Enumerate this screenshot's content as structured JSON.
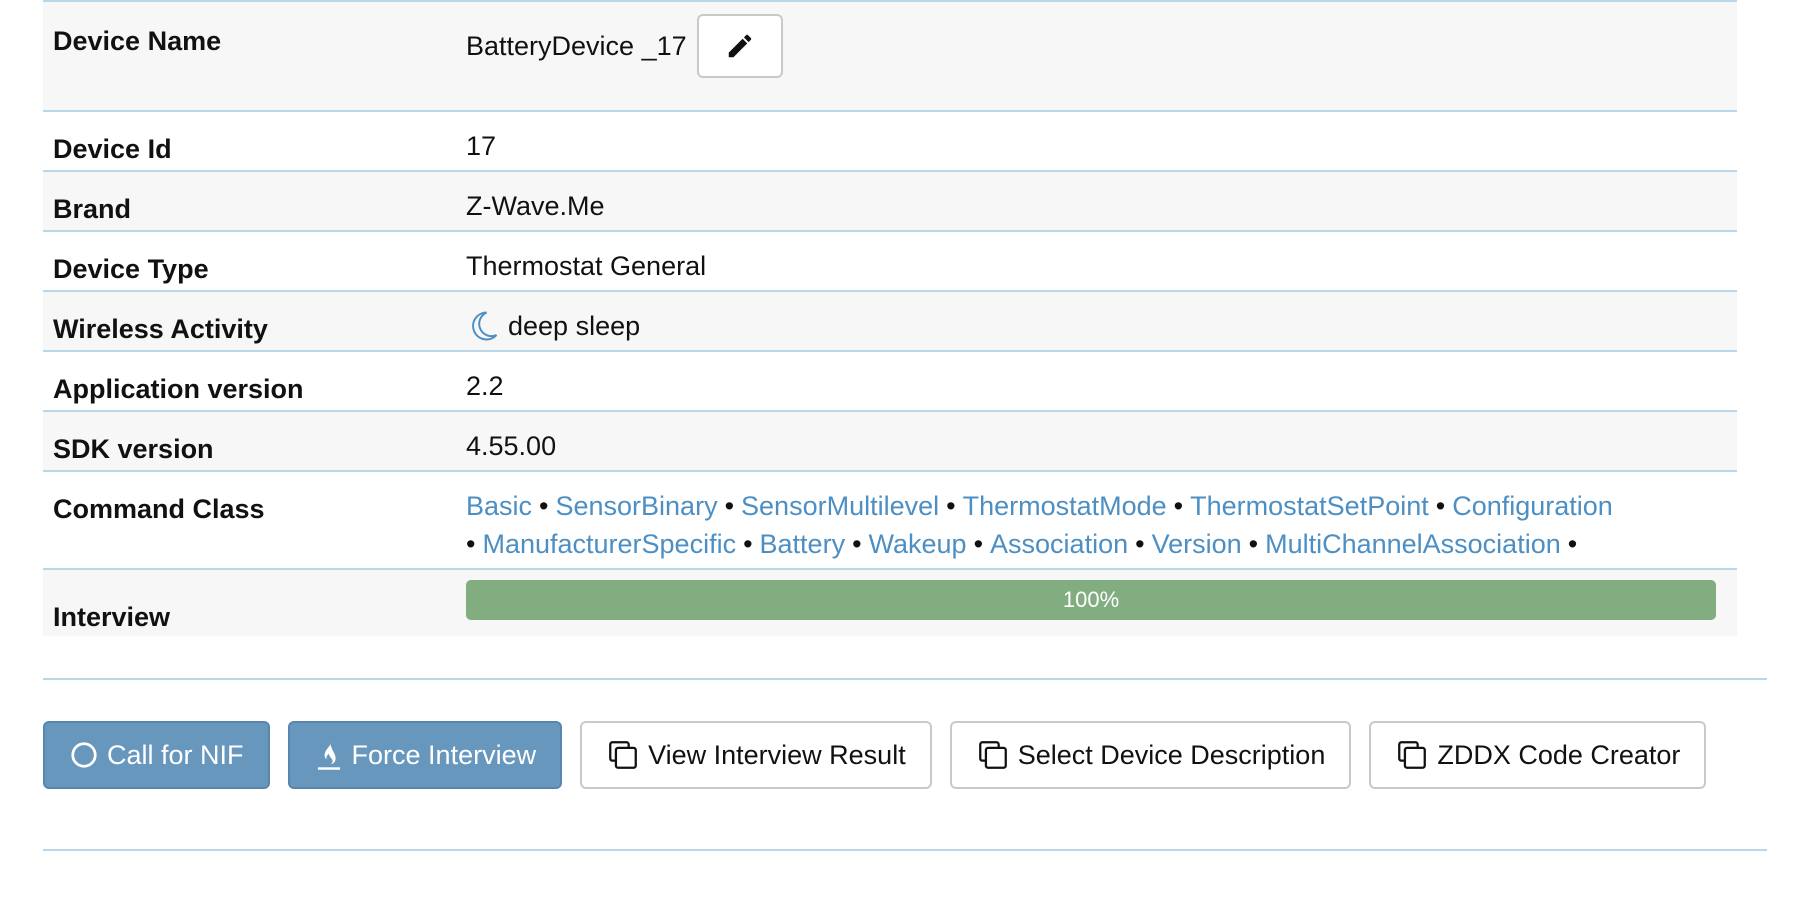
{
  "device": {
    "rows": {
      "name": {
        "label": "Device Name",
        "value": "BatteryDevice _17"
      },
      "id": {
        "label": "Device Id",
        "value": "17"
      },
      "brand": {
        "label": "Brand",
        "value": "Z-Wave.Me"
      },
      "type": {
        "label": "Device Type",
        "value": "Thermostat General"
      },
      "wireless": {
        "label": "Wireless Activity",
        "value": "deep sleep",
        "icon": "moon-icon"
      },
      "app_version": {
        "label": "Application version",
        "value": "2.2"
      },
      "sdk_version": {
        "label": "SDK version",
        "value": "4.55.00"
      },
      "command_class": {
        "label": "Command Class"
      },
      "interview": {
        "label": "Interview",
        "progress_text": "100%",
        "progress": 100
      }
    },
    "command_classes": [
      "Basic",
      "SensorBinary",
      "SensorMultilevel",
      "ThermostatMode",
      "ThermostatSetPoint",
      "Configuration",
      "ManufacturerSpecific",
      "Battery",
      "Wakeup",
      "Association",
      "Version",
      "MultiChannelAssociation"
    ],
    "separator": "•"
  },
  "buttons": {
    "call_nif": {
      "label": "Call for NIF",
      "icon": "circle-icon"
    },
    "force_interview": {
      "label": "Force Interview",
      "icon": "fire-icon"
    },
    "view_interview": {
      "label": "View Interview Result",
      "icon": "copy-icon"
    },
    "select_description": {
      "label": "Select Device Description",
      "icon": "copy-icon"
    },
    "zddx_creator": {
      "label": "ZDDX Code Creator",
      "icon": "copy-icon"
    }
  },
  "colors": {
    "link": "#4d8fc3",
    "primary_button": "#6897be",
    "progress": "#82ad80",
    "divider": "#b8d8ea"
  }
}
